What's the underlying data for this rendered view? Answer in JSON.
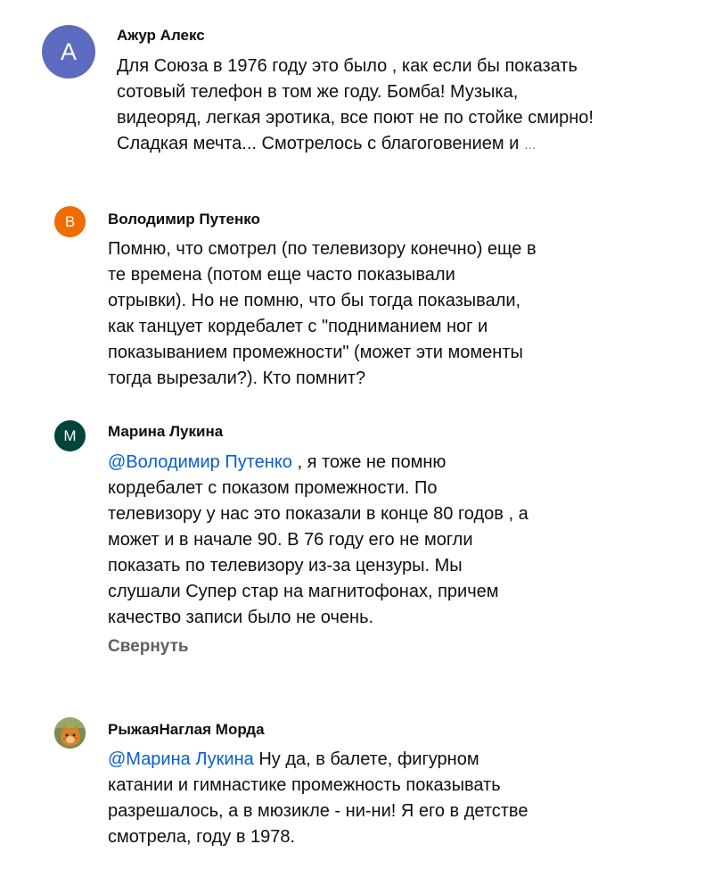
{
  "colors": {
    "avatar_a": "#5c6bc0",
    "avatar_b": "#ef6c00",
    "avatar_m": "#00443a",
    "mention": "#065fd4",
    "secondary_text": "#606060"
  },
  "comments": [
    {
      "author": "Ажур Алекс",
      "avatar_letter": "A",
      "lines": [
        "Для Союза в 1976 году это было  ,  как если бы показать",
        "сотовый телефон в том же году.  Бомба! Музыка,",
        "видеоряд, легкая эротика, все поют не по стойке смирно!",
        "Сладкая мечта...  Смотрелось с благоговением и "
      ],
      "more": "…"
    },
    {
      "author": "Володимир Путенко",
      "avatar_letter": "B",
      "lines": [
        "Помню, что смотрел (по телевизору конечно) еще в",
        "те времена (потом еще часто показывали",
        "отрывки). Но не помню, что бы тогда показывали,",
        "как танцует кордебалет с \"подниманием ног и",
        "показыванием промежности\" (может эти моменты",
        "тогда вырезали?). Кто помнит?"
      ]
    },
    {
      "author": "Марина Лукина",
      "avatar_letter": "M",
      "mention": "@Володимир Путенко",
      "first_line_rest": " , я тоже не помню",
      "lines": [
        "кордебалет с показом промежности. По",
        "телевизору у нас это показали в конце 80 годов , а",
        "может и в начале 90. В 76 году его не могли",
        "показать по телевизору из-за цензуры. Мы",
        "слушали Супер стар на магнитофонах, причем",
        "качество записи было не очень."
      ],
      "collapse_label": "Свернуть"
    },
    {
      "author": "РыжаяНаглая Морда",
      "avatar_icon": "cat-photo-icon",
      "mention": "@Марина Лукина",
      "first_line_rest": " Ну да, в балете, фигурном",
      "lines": [
        "катании и гимнастике промежность показывать",
        "разрешалось, а в мюзикле - ни-ни! Я его в детстве",
        "смотрела, году в 1978."
      ]
    }
  ]
}
